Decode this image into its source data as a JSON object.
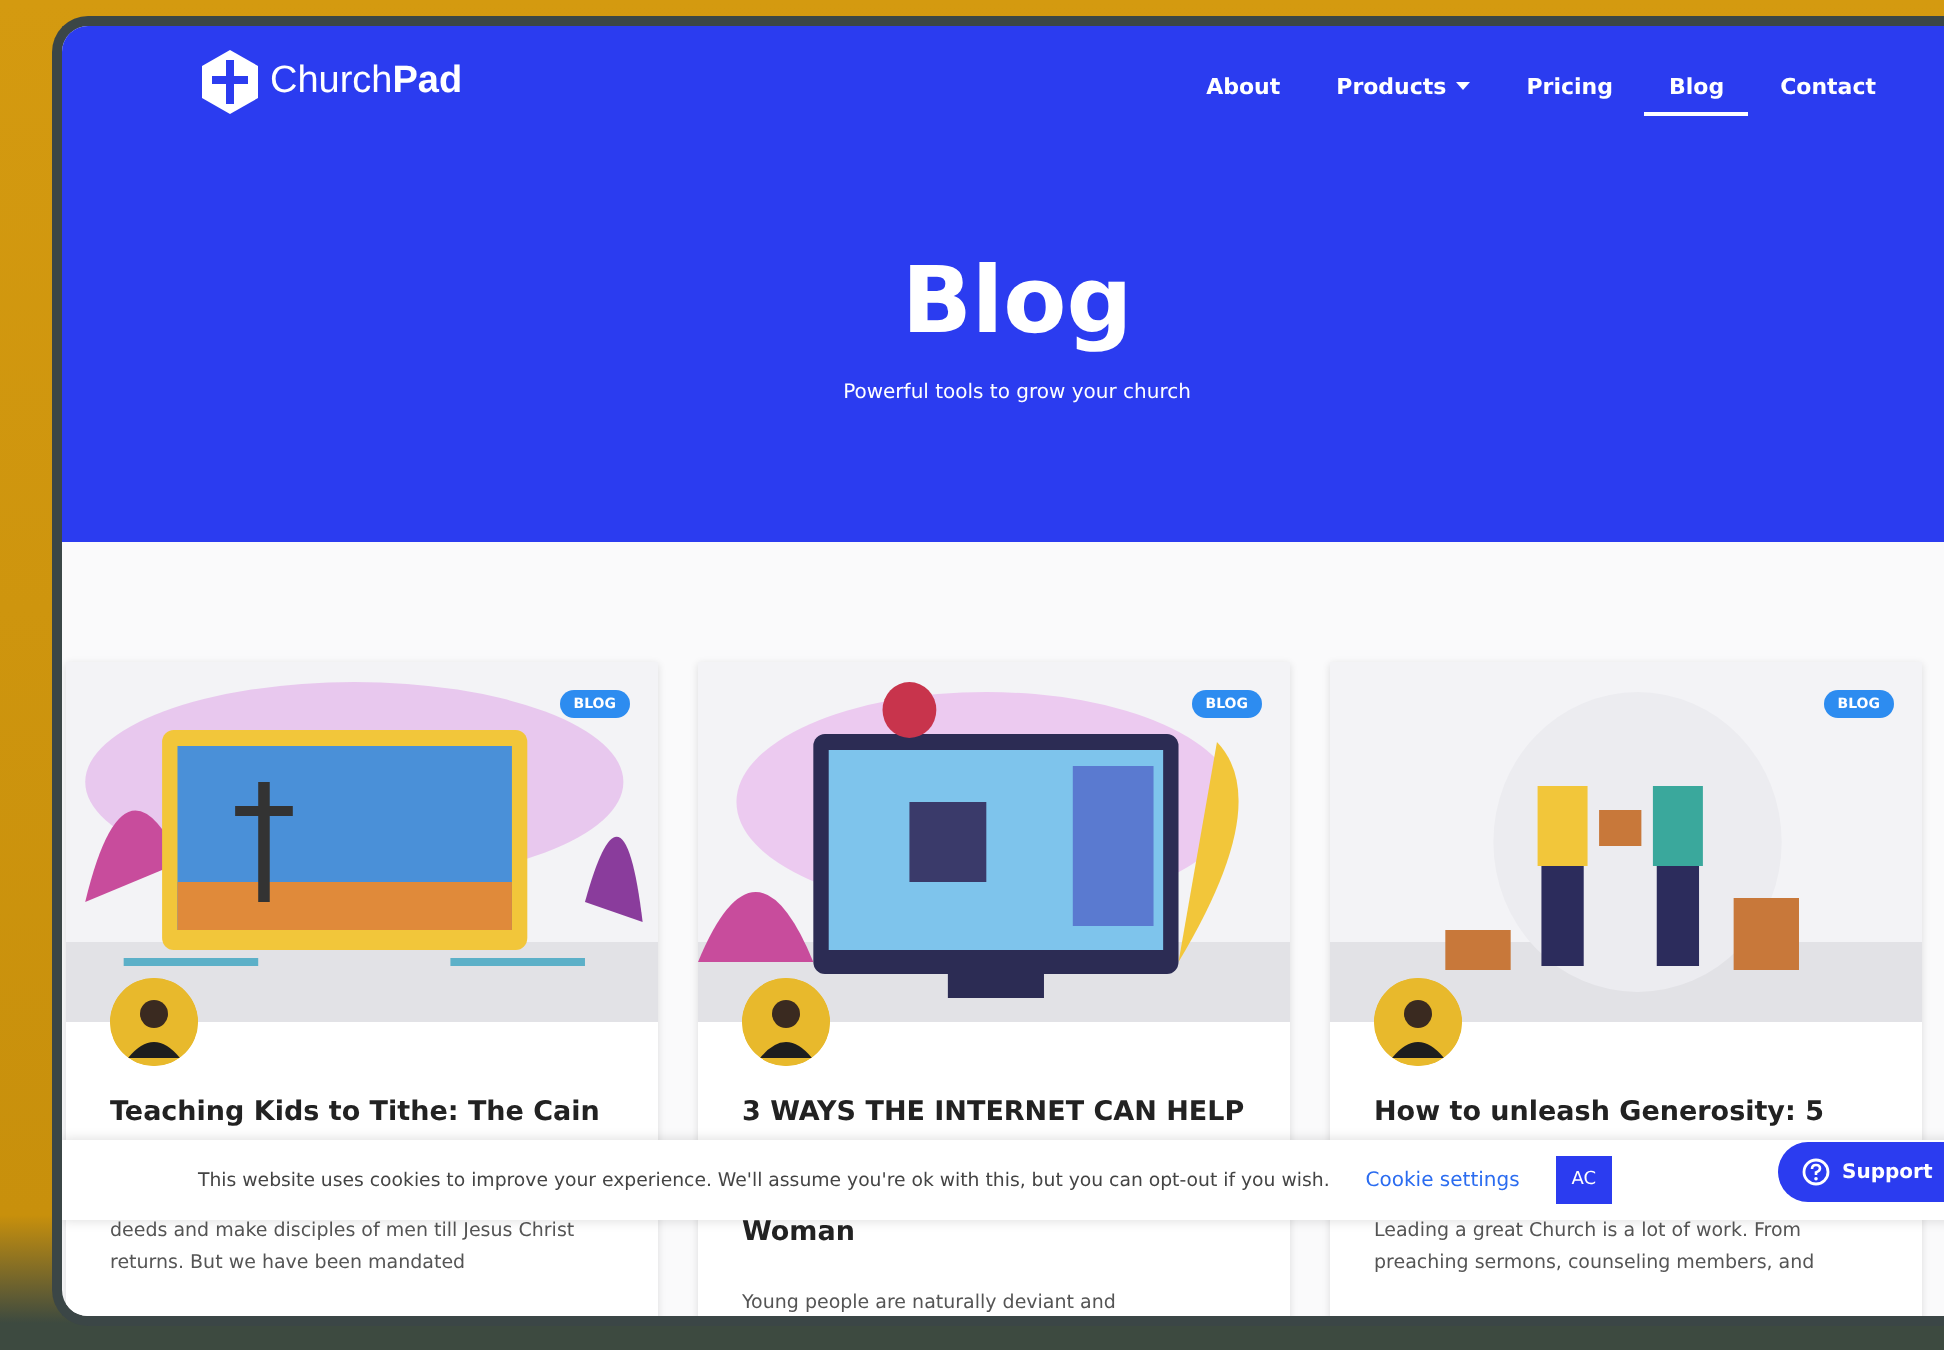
{
  "brand": {
    "name_light": "Church",
    "name_bold": "Pad"
  },
  "nav": [
    {
      "label": "About",
      "selected": false,
      "dropdown": false
    },
    {
      "label": "Products",
      "selected": false,
      "dropdown": true
    },
    {
      "label": "Pricing",
      "selected": false,
      "dropdown": false
    },
    {
      "label": "Blog",
      "selected": true,
      "dropdown": false
    },
    {
      "label": "Contact",
      "selected": false,
      "dropdown": false
    }
  ],
  "hero": {
    "title": "Blog",
    "subtitle": "Powerful tools to grow your church"
  },
  "cards": [
    {
      "badge": "BLOG",
      "title": "Teaching Kids to Tithe: The Cain",
      "excerpt": [
        "deeds and make disciples of men till Jesus Christ",
        "returns. But we have been mandated"
      ]
    },
    {
      "badge": "BLOG",
      "title": "3 WAYS THE INTERNET CAN HELP",
      "title_more": "Woman",
      "excerpt": [
        "Young people are naturally deviant and"
      ]
    },
    {
      "badge": "BLOG",
      "title": "How to unleash Generosity: 5",
      "excerpt": [
        "Leading a great Church is a lot of work. From",
        "preaching sermons, counseling members, and"
      ]
    }
  ],
  "cookie_bar": {
    "text": "This website uses cookies to improve your experience. We'll assume you're ok with this, but you can opt-out if you wish.",
    "settings_link": "Cookie settings",
    "accept_button": "AC"
  },
  "support_button": {
    "label": "Support"
  }
}
